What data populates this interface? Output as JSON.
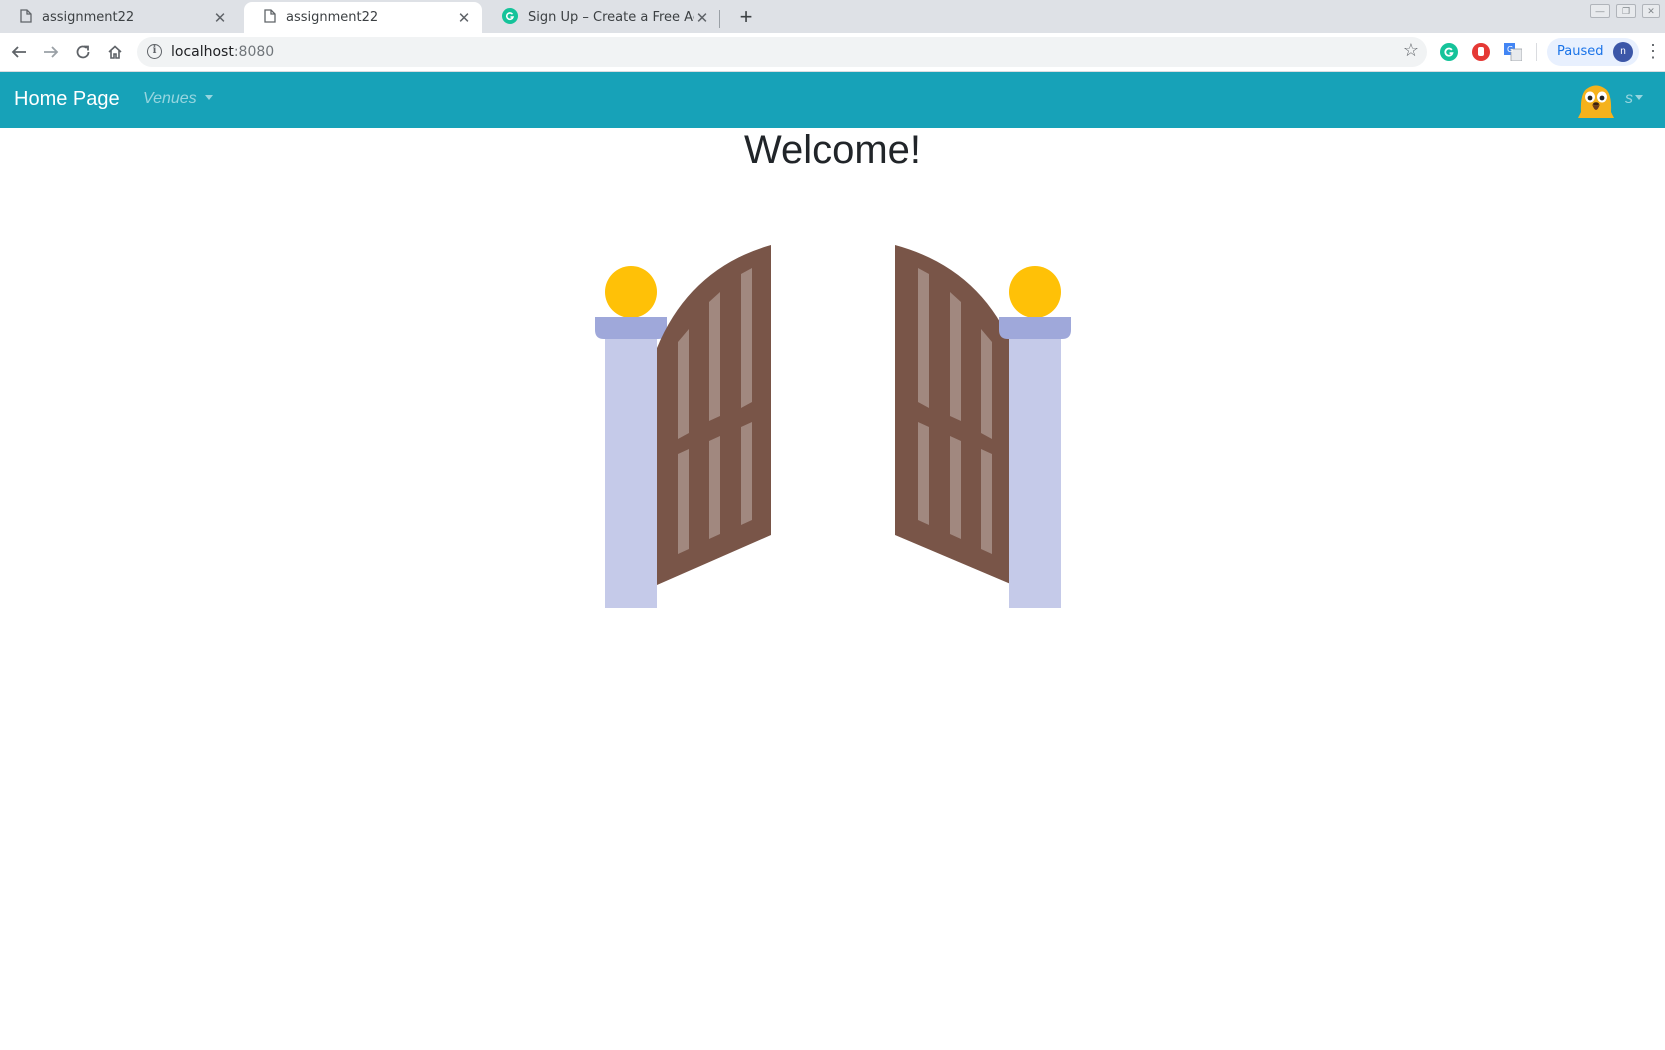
{
  "browser": {
    "tabs": [
      {
        "title": "assignment22",
        "icon": "page-icon",
        "active": false
      },
      {
        "title": "assignment22",
        "icon": "page-icon",
        "active": true
      },
      {
        "title": "Sign Up – Create a Free Account",
        "icon": "grammarly-icon",
        "active": false
      }
    ],
    "address": {
      "host": "localhost",
      "port": ":8080"
    },
    "profile": {
      "label": "Paused",
      "initial": "n"
    }
  },
  "navbar": {
    "brand": "Home Page",
    "venues_label": "Venues",
    "user_label": "s",
    "accent_color": "#17a2b8"
  },
  "main": {
    "heading": "Welcome!",
    "illustration": "open-gate-icon"
  }
}
